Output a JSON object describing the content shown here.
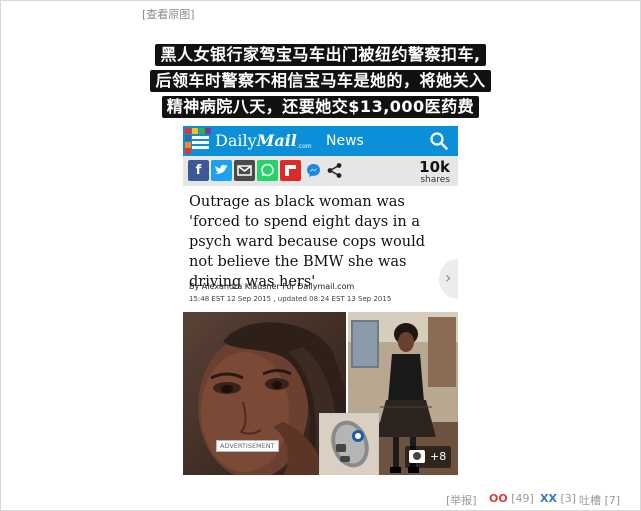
{
  "post": {
    "view_original": "[查看原图]",
    "caption_lines": [
      "黑人女银行家驾宝马车出门被纽约警察扣车,",
      "后领车时警察不相信宝马车是她的，将她关入",
      "精神病院八天，还要她交$13,000医药费"
    ]
  },
  "article": {
    "brand_light": "Daily",
    "brand_bold": "Mail",
    "brand_com": ".com",
    "section": "News",
    "share_count": "10k",
    "share_label": "shares",
    "share_icons": [
      "facebook-icon",
      "twitter-icon",
      "email-icon",
      "whatsapp-icon",
      "flipboard-icon",
      "messenger-icon",
      "share-icon"
    ],
    "headline": "Outrage as black woman was 'forced to spend eight days in a psych ward because cops would not believe the BMW she was driving was hers'",
    "byline": "By Alexandra Klausner For Dailymail.com",
    "timestamp": "15:48 EST 12 Sep 2015 , updated 08:24 EST 13 Sep 2015",
    "ad_label": "ADVERTISEMENT",
    "photo_count": "+8"
  },
  "footer": {
    "report": "[举报]",
    "oo_label": "OO",
    "oo_count": "[49]",
    "xx_label": "XX",
    "xx_count": "[3]",
    "comments": "吐槽 [7]"
  },
  "colors": {
    "dailymail_blue": "#0a8fd8",
    "oo_red": "#e0393e",
    "xx_blue": "#3575c6"
  }
}
